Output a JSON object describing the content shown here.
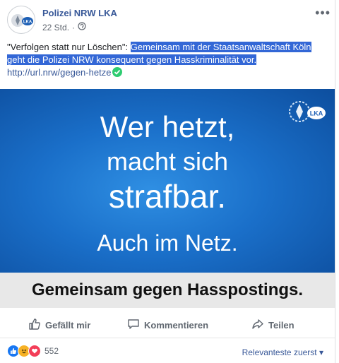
{
  "page": {
    "name": "Polizei NRW LKA",
    "time": "22 Std.",
    "separator": "·"
  },
  "post": {
    "text_plain": "\"Verfolgen statt nur Löschen\": ",
    "text_highlighted": "Gemeinsam mit der Staatsanwaltschaft Köln geht die Polizei NRW konsequent gegen Hasskriminalität vor.",
    "link": "http://url.nrw/gegen-hetze"
  },
  "banner": {
    "line1": "Wer hetzt,",
    "line2": "macht sich",
    "line3": "strafbar.",
    "line4": "Auch im Netz.",
    "logo_text": "LKA",
    "strip": "Gemeinsam gegen Hasspostings."
  },
  "actions": {
    "like": "Gefällt mir",
    "comment": "Kommentieren",
    "share": "Teilen"
  },
  "reactions": {
    "count": "552",
    "sort_label": "Relevanteste zuerst",
    "icons": [
      "like-icon",
      "haha-icon",
      "love-icon"
    ]
  },
  "colors": {
    "link": "#385898",
    "highlight": "#3367d6",
    "banner": "#1a6fc9"
  }
}
